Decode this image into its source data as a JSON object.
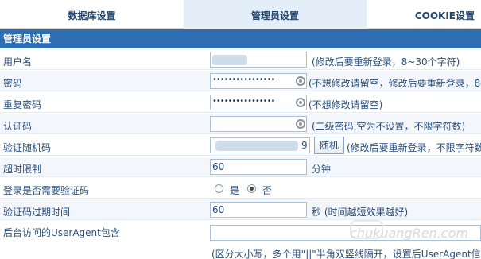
{
  "tabs": [
    {
      "label": "数据库设置"
    },
    {
      "label": "管理员设置"
    },
    {
      "label": "COOKIE设置"
    }
  ],
  "section": {
    "title": "管理员设置"
  },
  "rows": {
    "username": {
      "label": "用户名",
      "hint": "(修改后要重新登录，8~30个字符)"
    },
    "password": {
      "label": "密码",
      "value": "••••••••••••••••",
      "hint": "(不想修改请留空，修改后要重新登录，8"
    },
    "password_repeat": {
      "label": "重复密码",
      "value": "••••••••••••••••",
      "hint": "(不想修改请留空)"
    },
    "auth_code": {
      "label": "认证码",
      "hint": "(二级密码,空为不设置，不限字符数)"
    },
    "verify_random": {
      "label": "验证随机码",
      "value_suffix": "9",
      "button": "随机",
      "hint": "(修改后要重新登录，不限字符数"
    },
    "timeout": {
      "label": "超时限制",
      "value": "60",
      "unit": "分钟"
    },
    "login_captcha": {
      "label": "登录是否需要验证码",
      "yes": "是",
      "no": "否",
      "selected": "no"
    },
    "captcha_expire": {
      "label": "验证码过期时间",
      "value": "60",
      "unit": "秒 (时间越短效果越好)"
    },
    "useragent": {
      "label": "后台访问的UserAgent包含",
      "hint": "(区分大小写，多个用\"||\"半角双竖线隔开，设置后UserAgent信息"
    }
  },
  "watermark": "chukuangRen.com",
  "colors": {
    "header_bg": "#2f6db3",
    "active_tab_bg": "#e4eef8",
    "text": "#2b4f7a"
  }
}
